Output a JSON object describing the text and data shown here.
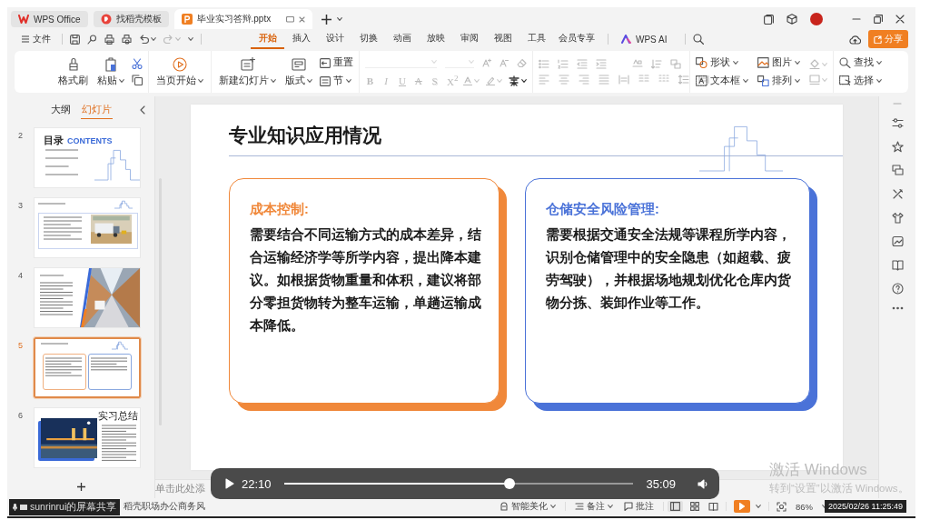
{
  "tabs": [
    {
      "label": "WPS Office",
      "kind": "home",
      "selected": false
    },
    {
      "label": "找稻壳模板",
      "kind": "template",
      "selected": false
    },
    {
      "label": "毕业实习答辩.pptx",
      "kind": "document",
      "selected": true
    }
  ],
  "menu": {
    "file": "文件",
    "tabs": [
      {
        "label": "开始",
        "selected": true
      },
      {
        "label": "插入",
        "selected": false
      },
      {
        "label": "设计",
        "selected": false
      },
      {
        "label": "切换",
        "selected": false
      },
      {
        "label": "动画",
        "selected": false
      },
      {
        "label": "放映",
        "selected": false
      },
      {
        "label": "审阅",
        "selected": false
      },
      {
        "label": "视图",
        "selected": false
      },
      {
        "label": "工具",
        "selected": false
      },
      {
        "label": "会员专享",
        "selected": false
      }
    ],
    "ai": "WPS AI",
    "share": "分享"
  },
  "ribbon": {
    "clipboard": [
      {
        "label": "格式刷",
        "dropdown": false
      },
      {
        "label": "粘贴",
        "dropdown": true
      }
    ],
    "play": {
      "label": "当页开始",
      "dropdown": true
    },
    "slides": [
      {
        "label": "新建幻灯片",
        "dropdown": true
      },
      {
        "label": "版式",
        "dropdown": true
      },
      {
        "label": "重置",
        "dropdown": false
      },
      {
        "label": "节",
        "dropdown": true
      }
    ],
    "format_marks": [
      {
        "label": "B",
        "kind": "bold",
        "disabled": true
      },
      {
        "label": "I",
        "kind": "italic",
        "disabled": true
      },
      {
        "label": "U",
        "kind": "underline",
        "disabled": true
      },
      {
        "label": "A",
        "kind": "strike",
        "disabled": true
      },
      {
        "label": "S",
        "kind": "shadow",
        "disabled": true
      },
      {
        "label": "X$^{2}$",
        "kind": "superscript",
        "disabled": true
      }
    ],
    "insert": [
      {
        "label": "形状",
        "dropdown": true
      },
      {
        "label": "图片",
        "dropdown": true
      },
      {
        "label": "文本框",
        "dropdown": true
      },
      {
        "label": "排列",
        "dropdown": true
      }
    ],
    "find": [
      {
        "label": "查找",
        "dropdown": true
      },
      {
        "label": "选择",
        "dropdown": true
      }
    ]
  },
  "panel_tabs": [
    {
      "label": "大纲",
      "selected": false
    },
    {
      "label": "幻灯片",
      "selected": true
    }
  ],
  "thumbnails": [
    {
      "number": "2",
      "kind": "contents",
      "title": "目录",
      "subtitle": "CONTENTS",
      "selected": false
    },
    {
      "number": "3",
      "kind": "text_photo",
      "selected": false
    },
    {
      "number": "4",
      "kind": "photo_side",
      "selected": false
    },
    {
      "number": "5",
      "kind": "two_cards",
      "selected": true
    },
    {
      "number": "6",
      "kind": "summary",
      "title": "实习总结",
      "selected": false
    }
  ],
  "slide": {
    "title": "专业知识应用情况",
    "cards": [
      {
        "heading": "成本控制:",
        "body": "需要结合不同运输方式的成本差异，结合运输经济学等所学内容，提出降本建议。如根据货物重量和体积，建议将部分零担货物转为整车运输，单趟运输成本降低。",
        "color": "#f0883a"
      },
      {
        "heading": "仓储安全风险管理:",
        "body": "需要根据交通安全法规等课程所学内容，识别仓储管理中的安全隐患（如超载、疲劳驾驶），并根据场地规划优化仓库内货物分拣、装卸作业等工作。",
        "color": "#4a72d8"
      }
    ]
  },
  "notes_placeholder": "单击此处添",
  "status_bar": {
    "share_label": "sunrinrui的屏幕共享",
    "theme": "稻壳职场办公商务风",
    "beautify": "智能美化",
    "notes": "备注",
    "comments": "批注",
    "zoom": "86%"
  },
  "video": {
    "current": "22:10",
    "level": 0.63,
    "total": "35:09"
  },
  "activation": {
    "title": "激活 Windows",
    "message": "转到“设置”以激活 Windows。"
  },
  "timestamp": "2025/02/26 11:25:49"
}
